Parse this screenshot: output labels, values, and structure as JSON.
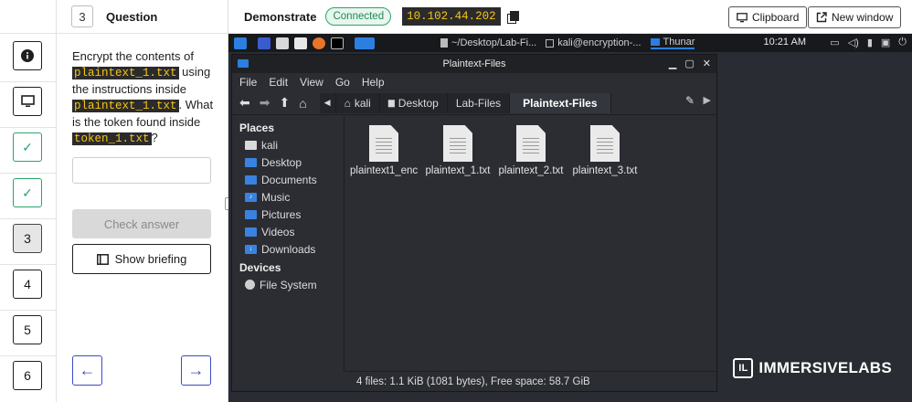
{
  "rail": {
    "steps": [
      {
        "label": "i",
        "icon": "info-icon",
        "state": "normal"
      },
      {
        "label": "",
        "icon": "monitor-icon",
        "state": "normal"
      },
      {
        "label": "✓",
        "icon": "check-icon",
        "state": "done"
      },
      {
        "label": "✓",
        "icon": "check-icon",
        "state": "done"
      },
      {
        "label": "3",
        "state": "current"
      },
      {
        "label": "4",
        "state": "normal"
      },
      {
        "label": "5",
        "state": "normal"
      },
      {
        "label": "6",
        "state": "normal"
      }
    ]
  },
  "question": {
    "number": "3",
    "title": "Question",
    "text_1": "Encrypt the contents of",
    "code_1": "plaintext_1.txt",
    "text_2": " using the instructions inside",
    "code_2": "plaintext_1.txt",
    "text_3": ". What is the token found inside",
    "code_3": "token_1.txt",
    "text_4": "?",
    "answer_value": "",
    "check_label": "Check answer",
    "briefing_label": "Show briefing",
    "prev_arrow": "←",
    "next_arrow": "→"
  },
  "topbar": {
    "mode": "Demonstrate",
    "status": "Connected",
    "ip": "10.102.44.202",
    "clipboard_label": "Clipboard",
    "new_window_label": "New window"
  },
  "kali_panel": {
    "tasks": [
      "~/Desktop/Lab-Fi...",
      "kali@encryption-...",
      "Thunar"
    ],
    "clock": "10:21 AM"
  },
  "thunar": {
    "title": "Plaintext-Files",
    "menu": [
      "File",
      "Edit",
      "View",
      "Go",
      "Help"
    ],
    "breadcrumbs": [
      "kali",
      "Desktop",
      "Lab-Files",
      "Plaintext-Files"
    ],
    "places_header": "Places",
    "places": [
      {
        "label": "kali",
        "icon": "home-icon"
      },
      {
        "label": "Desktop",
        "icon": "desktop-folder-icon"
      },
      {
        "label": "Documents",
        "icon": "documents-folder-icon"
      },
      {
        "label": "Music",
        "icon": "music-folder-icon"
      },
      {
        "label": "Pictures",
        "icon": "pictures-folder-icon"
      },
      {
        "label": "Videos",
        "icon": "videos-folder-icon"
      },
      {
        "label": "Downloads",
        "icon": "downloads-folder-icon"
      }
    ],
    "devices_header": "Devices",
    "devices": [
      {
        "label": "File System",
        "icon": "disk-icon"
      }
    ],
    "files": [
      "plaintext1_enc",
      "plaintext_1.txt",
      "plaintext_2.txt",
      "plaintext_3.txt"
    ],
    "status": "4 files: 1.1 KiB (1081 bytes), Free space: 58.7 GiB"
  },
  "brand": {
    "logo_text": "IMMERSIVELABS",
    "logo_mark": "IL"
  },
  "colors": {
    "accent": "#3b4cc0",
    "success": "#2aa36b",
    "code_bg": "#2b2b2b",
    "code_fg": "#f5c518",
    "desktop_bg": "#2a2c33"
  }
}
